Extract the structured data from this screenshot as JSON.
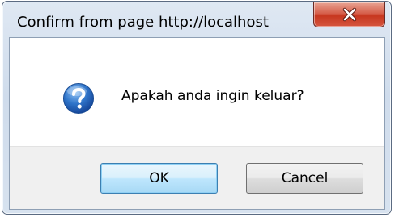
{
  "dialog": {
    "title": "Confirm from page http://localhost",
    "message": "Apakah anda ingin keluar?",
    "icon": "question-icon",
    "close_icon": "close-icon",
    "buttons": {
      "ok_label": "OK",
      "cancel_label": "Cancel"
    }
  },
  "colors": {
    "close_button": "#c7371f",
    "ok_button_border": "#3c7fb1",
    "question_icon": "#1f5fb8"
  }
}
